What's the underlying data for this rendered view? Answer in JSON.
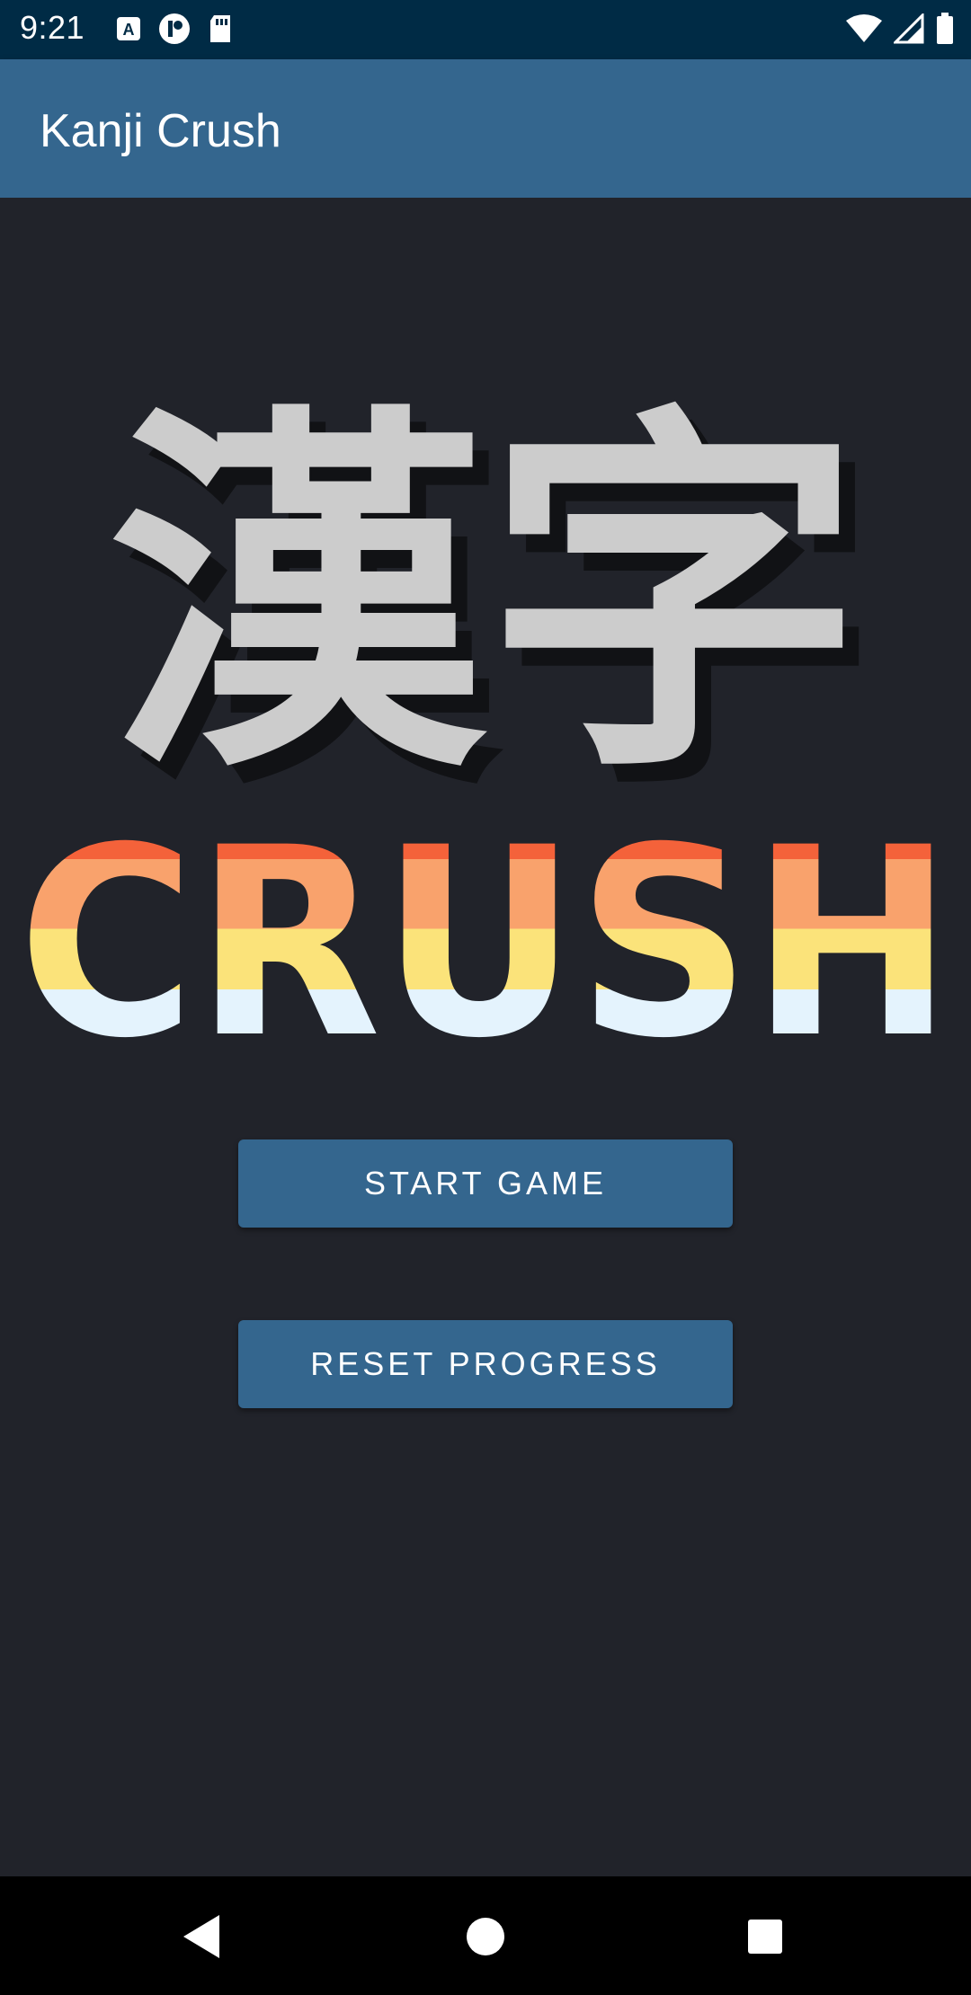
{
  "status_bar": {
    "time": "9:21",
    "left_icons": [
      "font-a-icon",
      "media-icon",
      "sd-card-icon"
    ],
    "right_icons": [
      "wifi-icon",
      "signal-icon",
      "battery-icon"
    ]
  },
  "app_bar": {
    "title": "Kanji Crush"
  },
  "logo": {
    "kanji_text": "漢字",
    "crush_text": "CRUSH",
    "colors": {
      "kanji": "#cccccc",
      "kanji_shadow": "#111215",
      "crush_bands": [
        "#f4623a",
        "#f9a26c",
        "#fbe37a",
        "#e4f3fd"
      ]
    }
  },
  "buttons": {
    "start_label": "START GAME",
    "reset_label": "RESET PROGRESS"
  },
  "nav_bar": {
    "icons": [
      "back-icon",
      "home-icon",
      "recents-icon"
    ]
  },
  "colors": {
    "status_bar": "#002b45",
    "app_bar": "#34668e",
    "background": "#21232a",
    "button": "#34668e"
  }
}
